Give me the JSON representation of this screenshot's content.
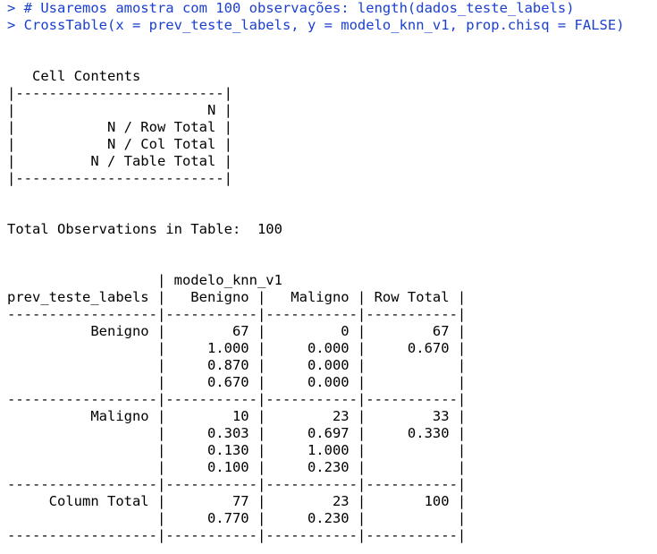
{
  "colors": {
    "input_text": "#1a3fd1",
    "output_text": "#000000",
    "background": "#ffffff"
  },
  "console": {
    "lines": [
      {
        "kind": "input",
        "text": "> # Usaremos amostra com 100 observações: length(dados_teste_labels)"
      },
      {
        "kind": "input",
        "text": "> CrossTable(x = prev_teste_labels, y = modelo_knn_v1, prop.chisq = FALSE)"
      },
      {
        "kind": "output",
        "text": ""
      },
      {
        "kind": "output",
        "text": ""
      },
      {
        "kind": "output",
        "text": "   Cell Contents"
      },
      {
        "kind": "output",
        "text": "|-------------------------|"
      },
      {
        "kind": "output",
        "text": "|                       N |"
      },
      {
        "kind": "output",
        "text": "|           N / Row Total |"
      },
      {
        "kind": "output",
        "text": "|           N / Col Total |"
      },
      {
        "kind": "output",
        "text": "|         N / Table Total |"
      },
      {
        "kind": "output",
        "text": "|-------------------------|"
      },
      {
        "kind": "output",
        "text": ""
      },
      {
        "kind": "output",
        "text": ""
      },
      {
        "kind": "output",
        "text": "Total Observations in Table:  100"
      },
      {
        "kind": "output",
        "text": ""
      },
      {
        "kind": "output",
        "text": ""
      },
      {
        "kind": "output",
        "text": "                  | modelo_knn_v1"
      },
      {
        "kind": "output",
        "text": "prev_teste_labels |   Benigno |   Maligno | Row Total |"
      },
      {
        "kind": "output",
        "text": "------------------|-----------|-----------|-----------|"
      },
      {
        "kind": "output",
        "text": "          Benigno |        67 |         0 |        67 |"
      },
      {
        "kind": "output",
        "text": "                  |     1.000 |     0.000 |     0.670 |"
      },
      {
        "kind": "output",
        "text": "                  |     0.870 |     0.000 |           |"
      },
      {
        "kind": "output",
        "text": "                  |     0.670 |     0.000 |           |"
      },
      {
        "kind": "output",
        "text": "------------------|-----------|-----------|-----------|"
      },
      {
        "kind": "output",
        "text": "          Maligno |        10 |        23 |        33 |"
      },
      {
        "kind": "output",
        "text": "                  |     0.303 |     0.697 |     0.330 |"
      },
      {
        "kind": "output",
        "text": "                  |     0.130 |     1.000 |           |"
      },
      {
        "kind": "output",
        "text": "                  |     0.100 |     0.230 |           |"
      },
      {
        "kind": "output",
        "text": "------------------|-----------|-----------|-----------|"
      },
      {
        "kind": "output",
        "text": "     Column Total |        77 |        23 |       100 |"
      },
      {
        "kind": "output",
        "text": "                  |     0.770 |     0.230 |           |"
      },
      {
        "kind": "output",
        "text": "------------------|-----------|-----------|-----------|"
      }
    ]
  }
}
